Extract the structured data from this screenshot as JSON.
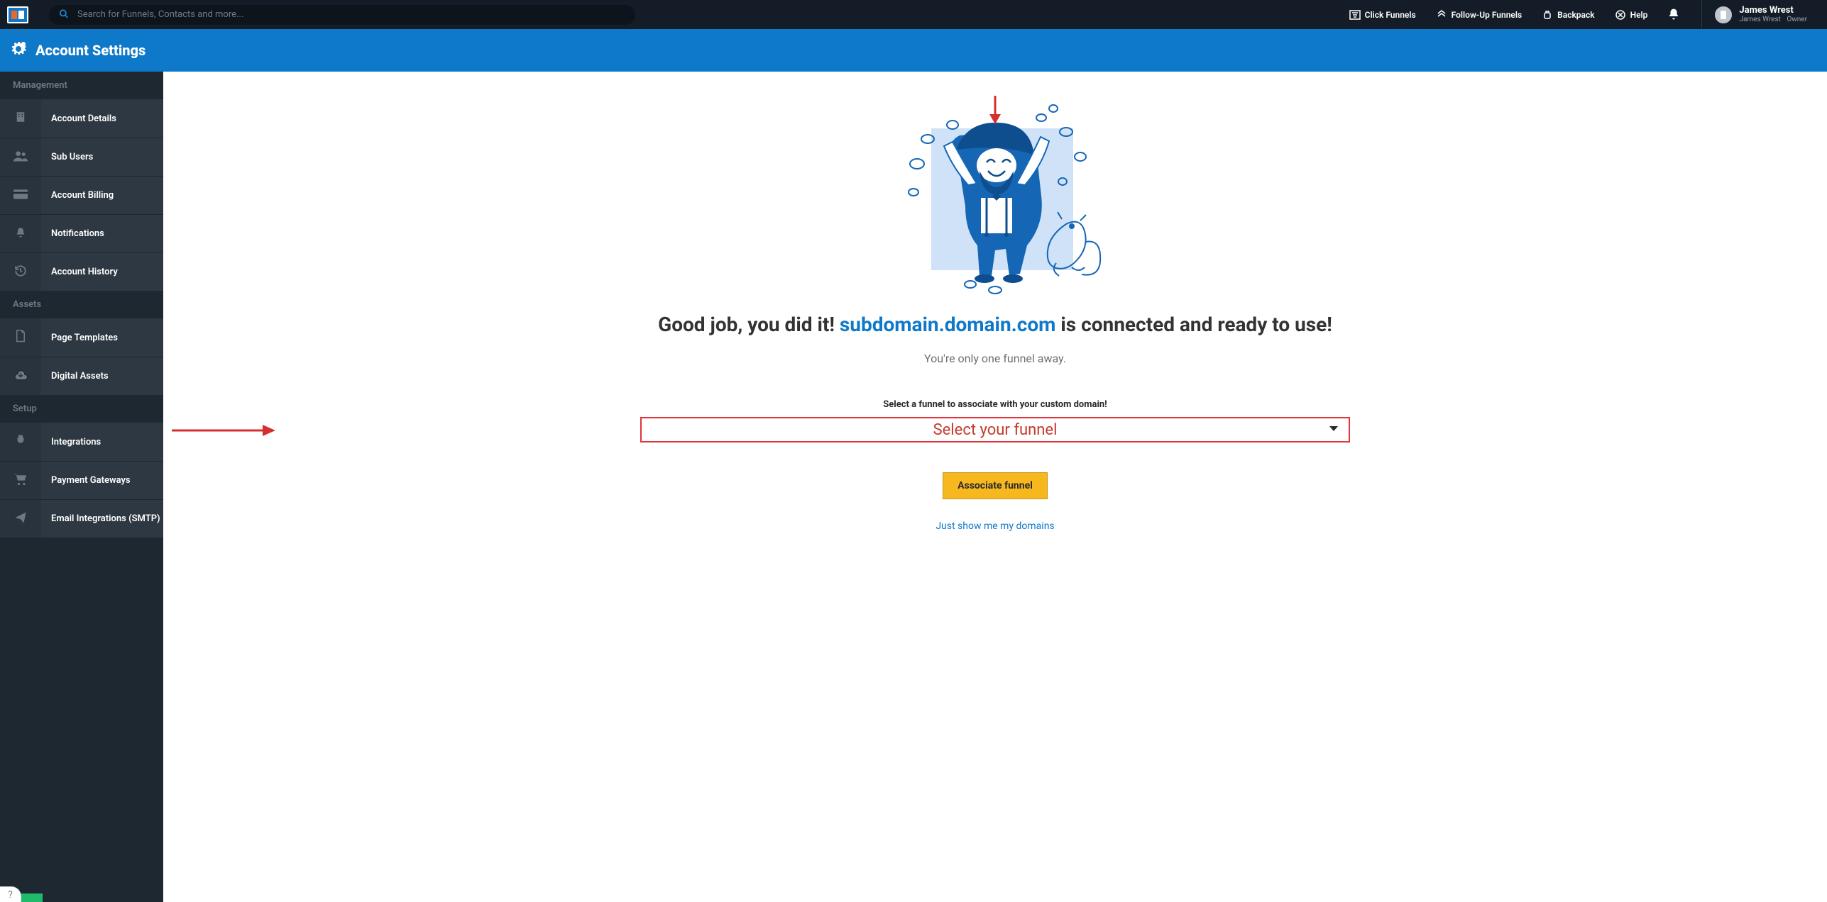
{
  "topbar": {
    "search_placeholder": "Search for Funnels, Contacts and more...",
    "nav": {
      "clickfunnels": "Click Funnels",
      "followup": "Follow-Up Funnels",
      "backpack": "Backpack",
      "help": "Help"
    },
    "profile": {
      "name": "James Wrest",
      "sub_name": "James Wrest",
      "role": "Owner"
    }
  },
  "banner": {
    "title": "Account Settings"
  },
  "sidebar": {
    "section_management": "Management",
    "section_assets": "Assets",
    "section_setup": "Setup",
    "items": {
      "account_details": "Account Details",
      "sub_users": "Sub Users",
      "account_billing": "Account Billing",
      "notifications": "Notifications",
      "account_history": "Account History",
      "page_templates": "Page Templates",
      "digital_assets": "Digital Assets",
      "integrations": "Integrations",
      "payment_gateways": "Payment Gateways",
      "email_integrations": "Email Integrations (SMTP)"
    }
  },
  "main": {
    "headline_pre": "Good job, you did it! ",
    "headline_domain": "subdomain.domain.com",
    "headline_post": " is connected and ready to use!",
    "subline": "You're only one funnel away.",
    "select_label": "Select a funnel to associate with your custom domain!",
    "select_placeholder": "Select your funnel",
    "associate_btn": "Associate funnel",
    "just_show_link": "Just show me my domains"
  },
  "help_bubble": "?"
}
